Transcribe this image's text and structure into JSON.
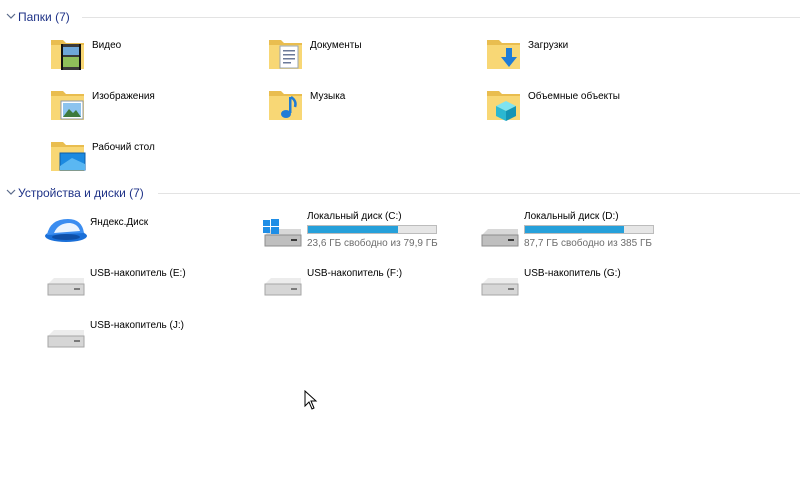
{
  "groups": {
    "folders": {
      "title": "Папки (7)"
    },
    "devices": {
      "title": "Устройства и диски (7)"
    }
  },
  "folders": [
    {
      "label": "Видео",
      "icon": "video-folder-icon"
    },
    {
      "label": "Документы",
      "icon": "documents-folder-icon"
    },
    {
      "label": "Загрузки",
      "icon": "downloads-folder-icon"
    },
    {
      "label": "Изображения",
      "icon": "pictures-folder-icon"
    },
    {
      "label": "Музыка",
      "icon": "music-folder-icon"
    },
    {
      "label": "Объемные объекты",
      "icon": "3d-objects-folder-icon"
    },
    {
      "label": "Рабочий стол",
      "icon": "desktop-folder-icon"
    }
  ],
  "devices": [
    {
      "label": "Яндекс.Диск",
      "icon": "yandex-disk-icon"
    },
    {
      "label": "Локальный диск (C:)",
      "sub": "23,6 ГБ свободно из 79,9 ГБ",
      "used_fraction": 0.705,
      "icon": "windows-drive-icon"
    },
    {
      "label": "Локальный диск (D:)",
      "sub": "87,7 ГБ свободно из 385 ГБ",
      "used_fraction": 0.772,
      "icon": "hard-drive-icon"
    },
    {
      "label": "USB-накопитель (E:)",
      "icon": "usb-drive-icon"
    },
    {
      "label": "USB-накопитель (F:)",
      "icon": "usb-drive-icon"
    },
    {
      "label": "USB-накопитель (G:)",
      "icon": "usb-drive-icon"
    },
    {
      "label": "USB-накопитель (J:)",
      "icon": "usb-drive-icon"
    }
  ],
  "colors": {
    "group_title": "#1e3287",
    "bar_fill": "#26a0da",
    "folder_yellow": "#f8d775"
  }
}
